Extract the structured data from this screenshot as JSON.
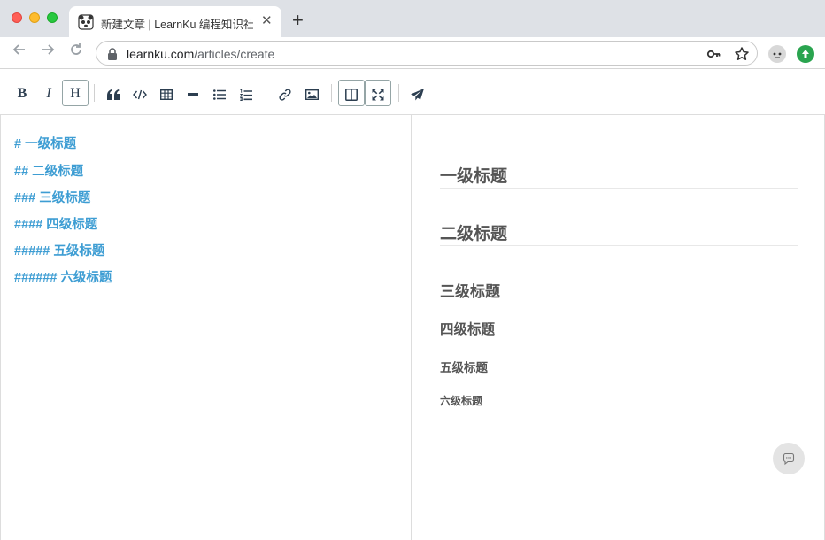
{
  "browser": {
    "tab_title": "新建文章 | LearnKu 编程知识社区",
    "tab_close": "✕",
    "new_tab": "+",
    "url_domain": "learnku.com",
    "url_path": "/articles/create"
  },
  "toolbar": {
    "bold": "B",
    "italic": "I",
    "heading": "H"
  },
  "editor": {
    "lines": [
      "# 一级标题",
      "## 二级标题",
      "### 三级标题",
      "#### 四级标题",
      "##### 五级标题",
      "###### 六级标题"
    ]
  },
  "preview": {
    "h1": "一级标题",
    "h2": "二级标题",
    "h3": "三级标题",
    "h4": "四级标题",
    "h5": "五级标题",
    "h6": "六级标题"
  },
  "colors": {
    "markdown_heading": "#3d9dd3",
    "preview_heading": "#555555",
    "toolbar_icon": "#2c3e50"
  },
  "icons": [
    "quote-icon",
    "code-icon",
    "table-icon",
    "horizontal-rule-icon",
    "unordered-list-icon",
    "ordered-list-icon",
    "link-icon",
    "image-icon",
    "side-by-side-icon",
    "fullscreen-icon",
    "publish-icon",
    "chat-icon"
  ]
}
